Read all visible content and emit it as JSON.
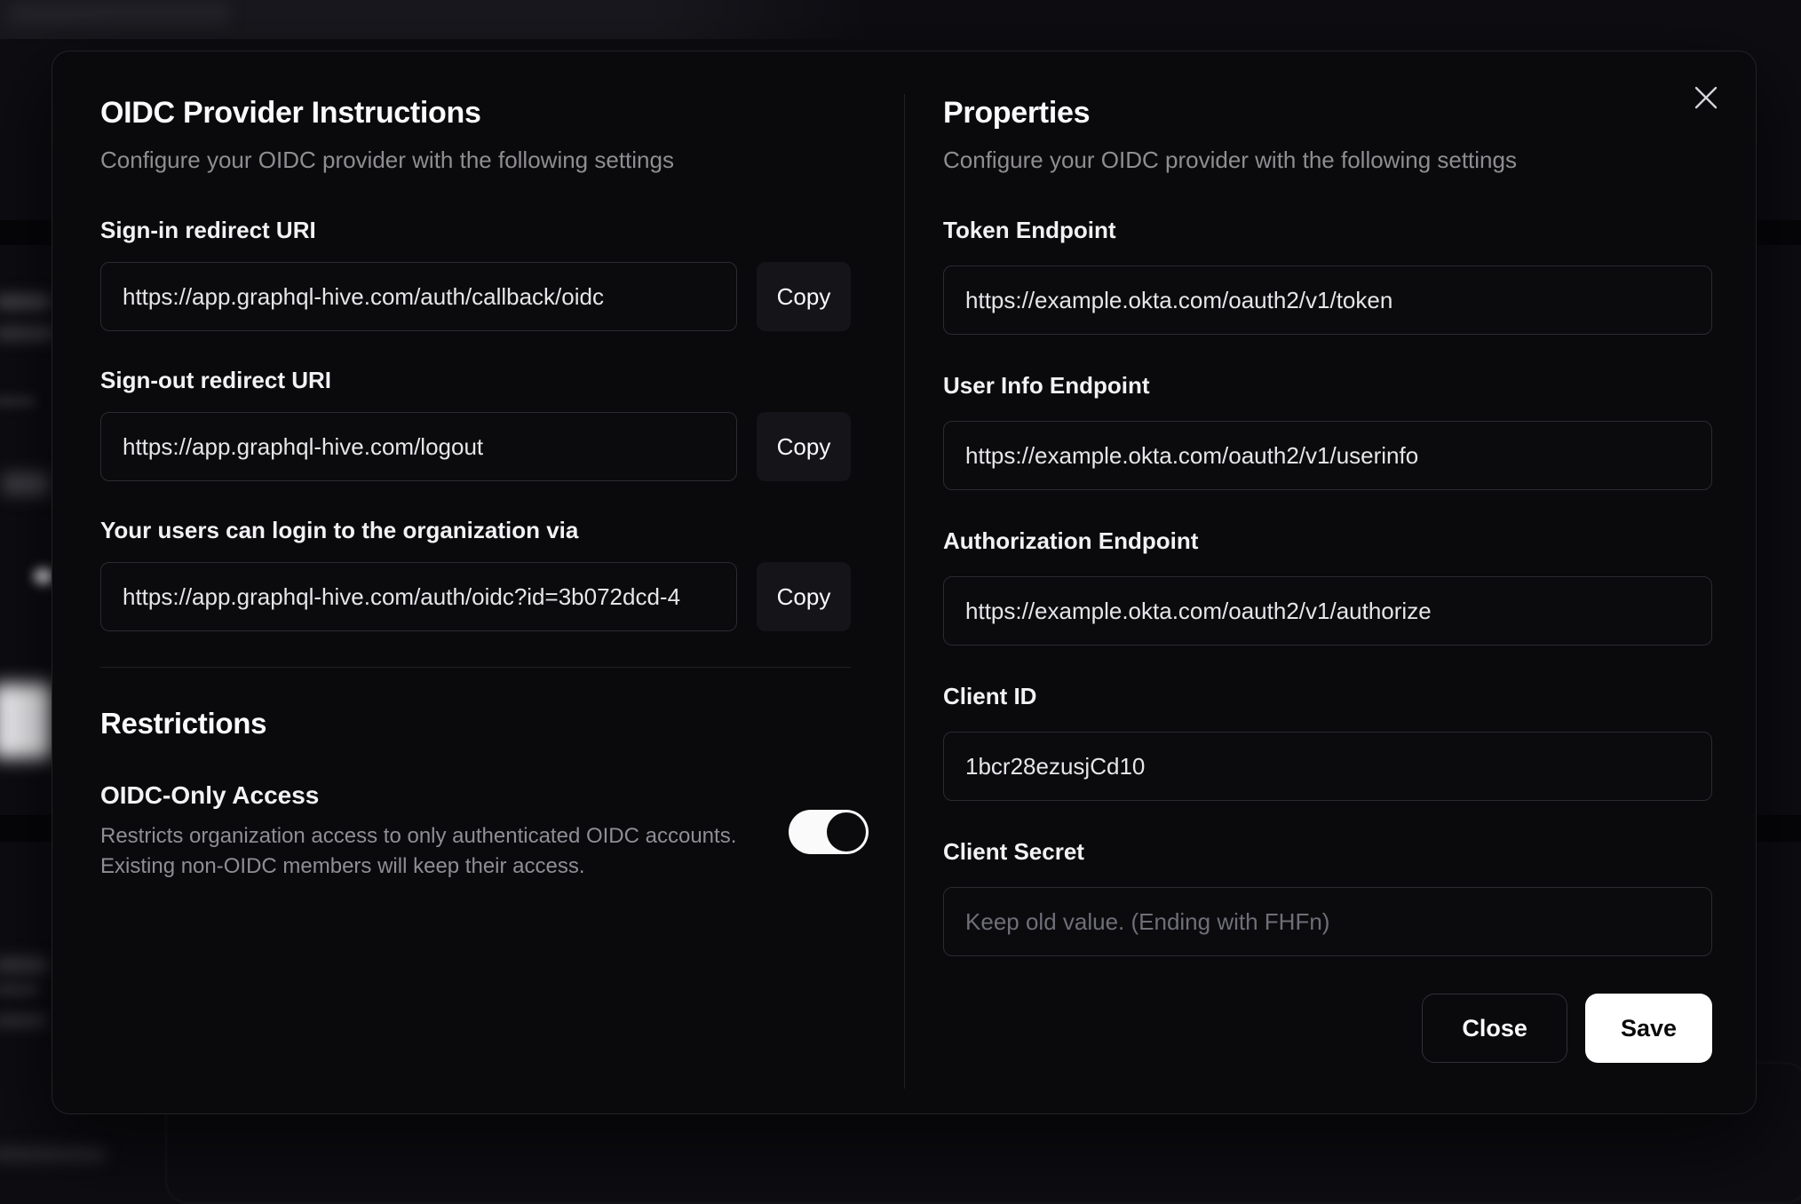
{
  "colors": {
    "modal_background": "#0a0a0d",
    "toggle_on": "#fafafa",
    "save_button": "#ffffff"
  },
  "modal": {
    "left": {
      "title": "OIDC Provider Instructions",
      "subtitle": "Configure your OIDC provider with the following settings",
      "fields": [
        {
          "label": "Sign-in redirect URI",
          "value": "https://app.graphql-hive.com/auth/callback/oidc",
          "copy": "Copy"
        },
        {
          "label": "Sign-out redirect URI",
          "value": "https://app.graphql-hive.com/logout",
          "copy": "Copy"
        },
        {
          "label": "Your users can login to the organization via",
          "value": "https://app.graphql-hive.com/auth/oidc?id=3b072dcd-4",
          "copy": "Copy"
        }
      ],
      "restrictions": {
        "title": "Restrictions",
        "toggle_label": "OIDC-Only Access",
        "description_lines": [
          "Restricts organization access to only authenticated OIDC accounts.",
          "Existing non-OIDC members will keep their access."
        ],
        "toggle_on": true
      }
    },
    "right": {
      "title": "Properties",
      "subtitle": "Configure your OIDC provider with the following settings",
      "fields": [
        {
          "label": "Token Endpoint",
          "value": "https://example.okta.com/oauth2/v1/token"
        },
        {
          "label": "User Info Endpoint",
          "value": "https://example.okta.com/oauth2/v1/userinfo"
        },
        {
          "label": "Authorization Endpoint",
          "value": "https://example.okta.com/oauth2/v1/authorize"
        },
        {
          "label": "Client ID",
          "value": "1bcr28ezusjCd10"
        },
        {
          "label": "Client Secret",
          "value": "",
          "placeholder": "Keep old value. (Ending with FHFn)"
        }
      ],
      "footer": {
        "close": "Close",
        "save": "Save"
      }
    }
  }
}
